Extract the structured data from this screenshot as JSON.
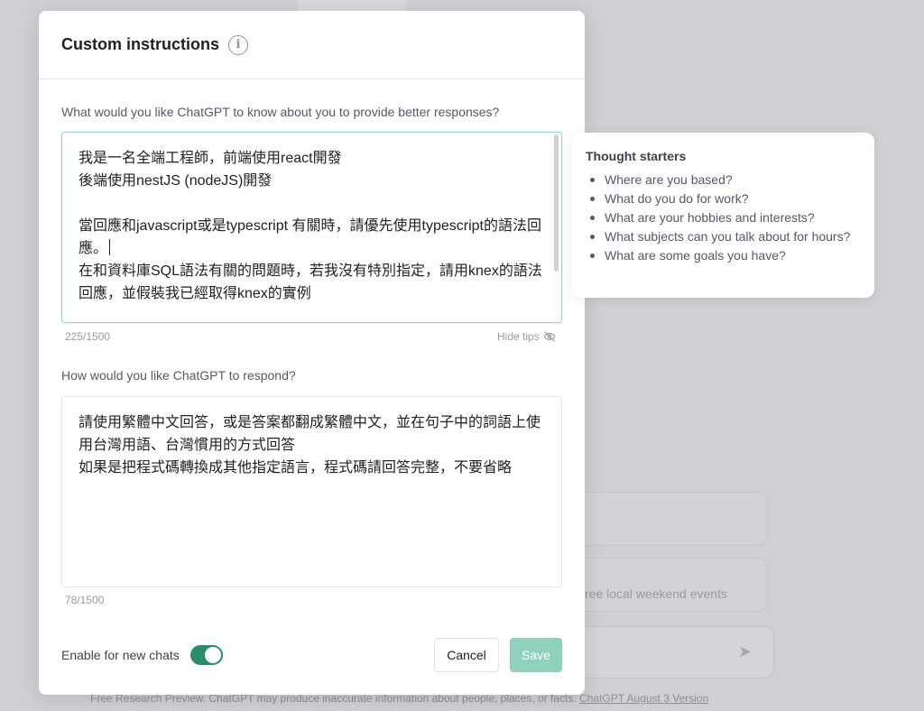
{
  "modal": {
    "title": "Custom instructions",
    "about_question": "What would you like ChatGPT to know about you to provide better responses?",
    "about_text": "我是一名全端工程師，前端使用react開發\n後端使用nestJS (nodeJS)開發\n\n當回應和javascript或是typescript 有關時，請優先使用typescript的語法回應。",
    "about_text_rest": "\n在和資料庫SQL語法有關的問題時，若我沒有特別指定，請用knex的語法回應，並假裝我已經取得knex的實例",
    "about_count": "225/1500",
    "hide_tips_label": "Hide tips",
    "respond_question": "How would you like ChatGPT to respond?",
    "respond_text": "請使用繁體中文回答，或是答案都翻成繁體中文，並在句子中的詞語上使用台灣用語、台灣慣用的方式回答\n如果是把程式碼轉換成其他指定語言，程式碼請回答完整，不要省略",
    "respond_count": "78/1500",
    "toggle_label": "Enable for new chats",
    "toggle_on": true,
    "cancel_label": "Cancel",
    "save_label": "Save"
  },
  "tips": {
    "title": "Thought starters",
    "items": [
      "Where are you based?",
      "What do you do for work?",
      "What are your hobbies and interests?",
      "What subjects can you talk about for hours?",
      "What are some goals you have?"
    ]
  },
  "background": {
    "card_text": "ree local weekend events",
    "footer_text": "Free Research Preview. ChatGPT may produce inaccurate information about people, places, or facts.",
    "footer_link": "ChatGPT August 3 Version"
  },
  "colors": {
    "accent": "#10a37f",
    "toggle": "#2b8c6b",
    "save_disabled": "#8fd1bd"
  }
}
